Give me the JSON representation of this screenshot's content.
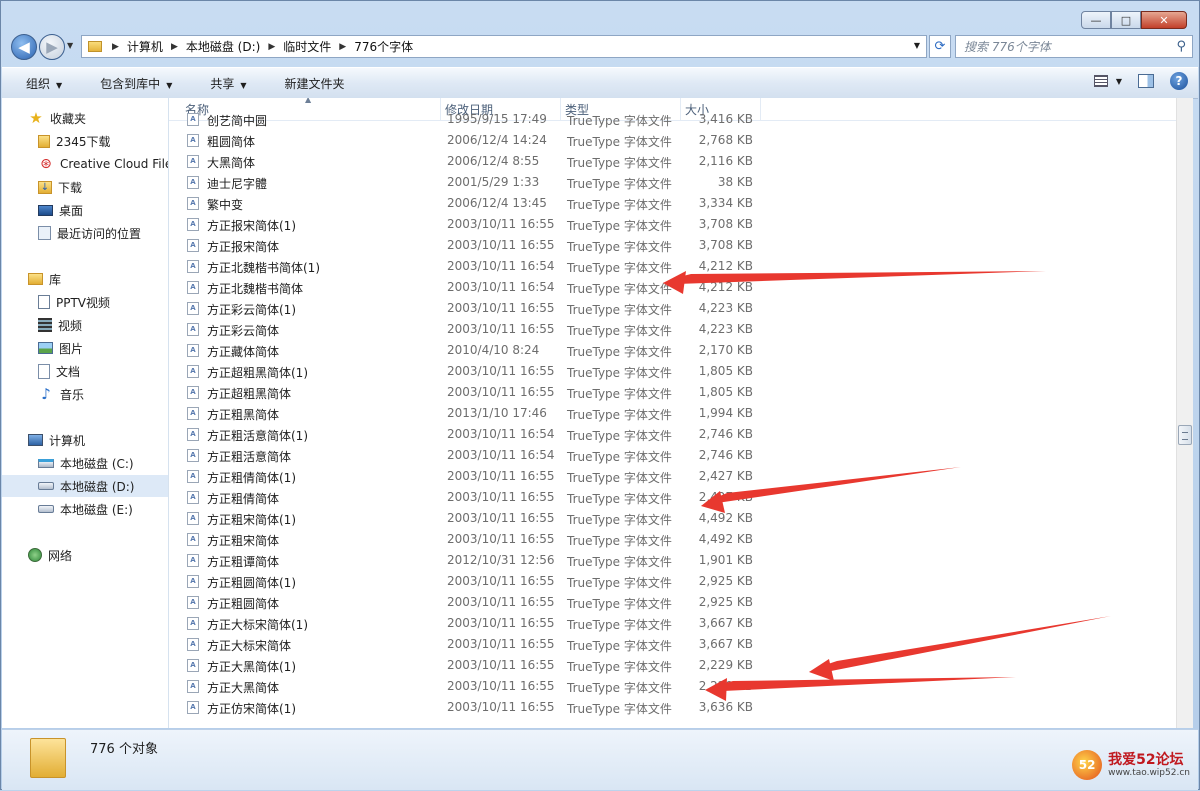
{
  "window": {
    "controls": {
      "minimize": "—",
      "maximize": "□",
      "close": "✕"
    }
  },
  "nav": {
    "back_icon": "back-arrow-icon",
    "forward_icon": "forward-arrow-icon",
    "breadcrumb": [
      "计算机",
      "本地磁盘 (D:)",
      "临时文件",
      "776个字体"
    ],
    "search_placeholder": "搜索 776个字体"
  },
  "toolbar": {
    "organize": "组织",
    "include_in_library": "包含到库中",
    "share": "共享",
    "new_folder": "新建文件夹"
  },
  "sidebar": {
    "favorites": {
      "label": "收藏夹",
      "items": [
        "2345下载",
        "Creative Cloud Files",
        "下载",
        "桌面",
        "最近访问的位置"
      ]
    },
    "libraries": {
      "label": "库",
      "items": [
        "PPTV视频",
        "视频",
        "图片",
        "文档",
        "音乐"
      ]
    },
    "computer": {
      "label": "计算机",
      "items": [
        "本地磁盘 (C:)",
        "本地磁盘 (D:)",
        "本地磁盘 (E:)"
      ]
    },
    "network": {
      "label": "网络"
    }
  },
  "columns": {
    "name": "名称",
    "date": "修改日期",
    "type": "类型",
    "size": "大小"
  },
  "file_icon_text": "A",
  "files": [
    {
      "name": "创艺简中圆",
      "date": "1995/9/15 17:49",
      "type": "TrueType 字体文件",
      "size": "3,416 KB"
    },
    {
      "name": "粗圆简体",
      "date": "2006/12/4 14:24",
      "type": "TrueType 字体文件",
      "size": "2,768 KB"
    },
    {
      "name": "大黑简体",
      "date": "2006/12/4 8:55",
      "type": "TrueType 字体文件",
      "size": "2,116 KB"
    },
    {
      "name": "迪士尼字體",
      "date": "2001/5/29 1:33",
      "type": "TrueType 字体文件",
      "size": "38 KB"
    },
    {
      "name": "繁中变",
      "date": "2006/12/4 13:45",
      "type": "TrueType 字体文件",
      "size": "3,334 KB"
    },
    {
      "name": "方正报宋简体(1)",
      "date": "2003/10/11 16:55",
      "type": "TrueType 字体文件",
      "size": "3,708 KB"
    },
    {
      "name": "方正报宋简体",
      "date": "2003/10/11 16:55",
      "type": "TrueType 字体文件",
      "size": "3,708 KB"
    },
    {
      "name": "方正北魏楷书简体(1)",
      "date": "2003/10/11 16:54",
      "type": "TrueType 字体文件",
      "size": "4,212 KB"
    },
    {
      "name": "方正北魏楷书简体",
      "date": "2003/10/11 16:54",
      "type": "TrueType 字体文件",
      "size": "4,212 KB"
    },
    {
      "name": "方正彩云简体(1)",
      "date": "2003/10/11 16:55",
      "type": "TrueType 字体文件",
      "size": "4,223 KB"
    },
    {
      "name": "方正彩云简体",
      "date": "2003/10/11 16:55",
      "type": "TrueType 字体文件",
      "size": "4,223 KB"
    },
    {
      "name": "方正藏体简体",
      "date": "2010/4/10 8:24",
      "type": "TrueType 字体文件",
      "size": "2,170 KB"
    },
    {
      "name": "方正超粗黑简体(1)",
      "date": "2003/10/11 16:55",
      "type": "TrueType 字体文件",
      "size": "1,805 KB"
    },
    {
      "name": "方正超粗黑简体",
      "date": "2003/10/11 16:55",
      "type": "TrueType 字体文件",
      "size": "1,805 KB"
    },
    {
      "name": "方正粗黑简体",
      "date": "2013/1/10 17:46",
      "type": "TrueType 字体文件",
      "size": "1,994 KB"
    },
    {
      "name": "方正粗活意简体(1)",
      "date": "2003/10/11 16:54",
      "type": "TrueType 字体文件",
      "size": "2,746 KB"
    },
    {
      "name": "方正粗活意简体",
      "date": "2003/10/11 16:54",
      "type": "TrueType 字体文件",
      "size": "2,746 KB"
    },
    {
      "name": "方正粗倩简体(1)",
      "date": "2003/10/11 16:55",
      "type": "TrueType 字体文件",
      "size": "2,427 KB"
    },
    {
      "name": "方正粗倩简体",
      "date": "2003/10/11 16:55",
      "type": "TrueType 字体文件",
      "size": "2,427 KB"
    },
    {
      "name": "方正粗宋简体(1)",
      "date": "2003/10/11 16:55",
      "type": "TrueType 字体文件",
      "size": "4,492 KB"
    },
    {
      "name": "方正粗宋简体",
      "date": "2003/10/11 16:55",
      "type": "TrueType 字体文件",
      "size": "4,492 KB"
    },
    {
      "name": "方正粗谭简体",
      "date": "2012/10/31 12:56",
      "type": "TrueType 字体文件",
      "size": "1,901 KB"
    },
    {
      "name": "方正粗圆简体(1)",
      "date": "2003/10/11 16:55",
      "type": "TrueType 字体文件",
      "size": "2,925 KB"
    },
    {
      "name": "方正粗圆简体",
      "date": "2003/10/11 16:55",
      "type": "TrueType 字体文件",
      "size": "2,925 KB"
    },
    {
      "name": "方正大标宋简体(1)",
      "date": "2003/10/11 16:55",
      "type": "TrueType 字体文件",
      "size": "3,667 KB"
    },
    {
      "name": "方正大标宋简体",
      "date": "2003/10/11 16:55",
      "type": "TrueType 字体文件",
      "size": "3,667 KB"
    },
    {
      "name": "方正大黑简体(1)",
      "date": "2003/10/11 16:55",
      "type": "TrueType 字体文件",
      "size": "2,229 KB"
    },
    {
      "name": "方正大黑简体",
      "date": "2003/10/11 16:55",
      "type": "TrueType 字体文件",
      "size": "2,229 KB"
    },
    {
      "name": "方正仿宋简体(1)",
      "date": "2003/10/11 16:55",
      "type": "TrueType 字体文件",
      "size": "3,636 KB"
    }
  ],
  "status": {
    "count": "776 个对象"
  },
  "watermark": {
    "logo": "52",
    "name": "我爱52论坛",
    "url": "www.tao.wip52.cn"
  },
  "colors": {
    "annotation_arrow": "#e8382f",
    "selection": "#dde9f7",
    "link_blue": "#2a6fc9"
  }
}
